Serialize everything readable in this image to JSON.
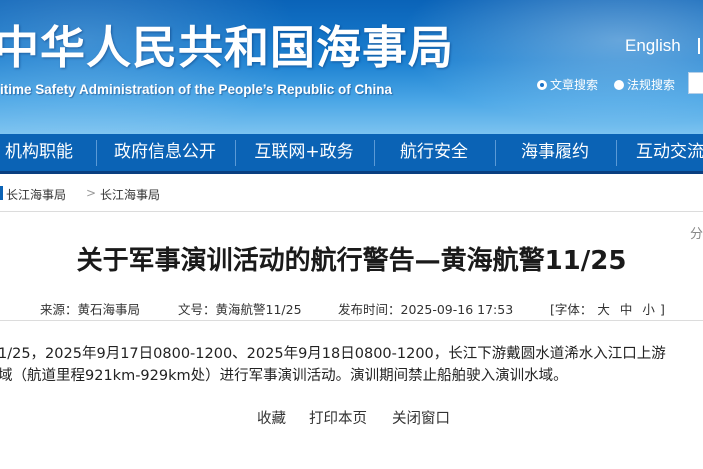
{
  "header": {
    "title": "中华人民共和国海事局",
    "subtitle": "itime Safety Administration of the People’s Republic of China",
    "english_link": "English",
    "search_options": [
      {
        "label": "文章搜索",
        "checked": true
      },
      {
        "label": "法规搜索",
        "checked": false
      }
    ]
  },
  "nav": {
    "items": [
      "机构职能",
      "政府信息公开",
      "互联网+政务",
      "航行安全",
      "海事履约",
      "互动交流"
    ]
  },
  "breadcrumb": {
    "items": [
      "长江海事局",
      "长江海事局"
    ],
    "separator": ">"
  },
  "article": {
    "share": "分",
    "title": "关于军事演训活动的航行警告—黄海航警11/25",
    "source_label": "来源：",
    "source": "黄石海事局",
    "doc_no_label": "文号：",
    "doc_no": "黄海航警11/25",
    "publish_label": "发布时间：",
    "publish_time": "2025-09-16 17:53",
    "font_label": "[字体：",
    "font_large": "大",
    "font_medium": "中",
    "font_small": "小",
    "font_end": "]",
    "paragraph_line1": "1/25，2025年9月17日0800-1200、2025年9月18日0800-1200，长江下游戴圆水道浠水入江口上游",
    "paragraph_line2": "域（航道里程921km-929km处）进行军事演训活动。演训期间禁止船舶驶入演训水域。"
  },
  "actions": {
    "favorite": "收藏",
    "print": "打印本页",
    "close": "关闭窗口"
  }
}
